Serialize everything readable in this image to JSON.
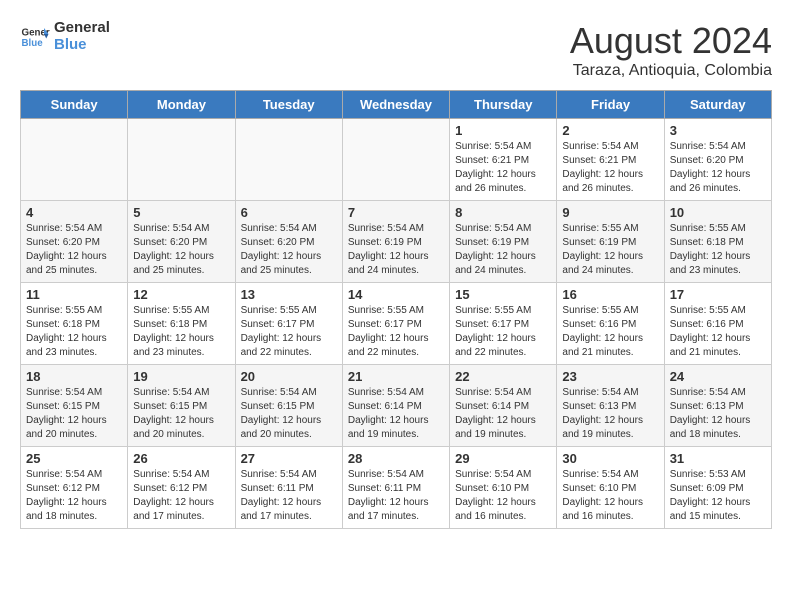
{
  "logo": {
    "line1": "General",
    "line2": "Blue"
  },
  "title": "August 2024",
  "subtitle": "Taraza, Antioquia, Colombia",
  "weekdays": [
    "Sunday",
    "Monday",
    "Tuesday",
    "Wednesday",
    "Thursday",
    "Friday",
    "Saturday"
  ],
  "weeks": [
    [
      {
        "day": "",
        "info": ""
      },
      {
        "day": "",
        "info": ""
      },
      {
        "day": "",
        "info": ""
      },
      {
        "day": "",
        "info": ""
      },
      {
        "day": "1",
        "info": "Sunrise: 5:54 AM\nSunset: 6:21 PM\nDaylight: 12 hours\nand 26 minutes."
      },
      {
        "day": "2",
        "info": "Sunrise: 5:54 AM\nSunset: 6:21 PM\nDaylight: 12 hours\nand 26 minutes."
      },
      {
        "day": "3",
        "info": "Sunrise: 5:54 AM\nSunset: 6:20 PM\nDaylight: 12 hours\nand 26 minutes."
      }
    ],
    [
      {
        "day": "4",
        "info": "Sunrise: 5:54 AM\nSunset: 6:20 PM\nDaylight: 12 hours\nand 25 minutes."
      },
      {
        "day": "5",
        "info": "Sunrise: 5:54 AM\nSunset: 6:20 PM\nDaylight: 12 hours\nand 25 minutes."
      },
      {
        "day": "6",
        "info": "Sunrise: 5:54 AM\nSunset: 6:20 PM\nDaylight: 12 hours\nand 25 minutes."
      },
      {
        "day": "7",
        "info": "Sunrise: 5:54 AM\nSunset: 6:19 PM\nDaylight: 12 hours\nand 24 minutes."
      },
      {
        "day": "8",
        "info": "Sunrise: 5:54 AM\nSunset: 6:19 PM\nDaylight: 12 hours\nand 24 minutes."
      },
      {
        "day": "9",
        "info": "Sunrise: 5:55 AM\nSunset: 6:19 PM\nDaylight: 12 hours\nand 24 minutes."
      },
      {
        "day": "10",
        "info": "Sunrise: 5:55 AM\nSunset: 6:18 PM\nDaylight: 12 hours\nand 23 minutes."
      }
    ],
    [
      {
        "day": "11",
        "info": "Sunrise: 5:55 AM\nSunset: 6:18 PM\nDaylight: 12 hours\nand 23 minutes."
      },
      {
        "day": "12",
        "info": "Sunrise: 5:55 AM\nSunset: 6:18 PM\nDaylight: 12 hours\nand 23 minutes."
      },
      {
        "day": "13",
        "info": "Sunrise: 5:55 AM\nSunset: 6:17 PM\nDaylight: 12 hours\nand 22 minutes."
      },
      {
        "day": "14",
        "info": "Sunrise: 5:55 AM\nSunset: 6:17 PM\nDaylight: 12 hours\nand 22 minutes."
      },
      {
        "day": "15",
        "info": "Sunrise: 5:55 AM\nSunset: 6:17 PM\nDaylight: 12 hours\nand 22 minutes."
      },
      {
        "day": "16",
        "info": "Sunrise: 5:55 AM\nSunset: 6:16 PM\nDaylight: 12 hours\nand 21 minutes."
      },
      {
        "day": "17",
        "info": "Sunrise: 5:55 AM\nSunset: 6:16 PM\nDaylight: 12 hours\nand 21 minutes."
      }
    ],
    [
      {
        "day": "18",
        "info": "Sunrise: 5:54 AM\nSunset: 6:15 PM\nDaylight: 12 hours\nand 20 minutes."
      },
      {
        "day": "19",
        "info": "Sunrise: 5:54 AM\nSunset: 6:15 PM\nDaylight: 12 hours\nand 20 minutes."
      },
      {
        "day": "20",
        "info": "Sunrise: 5:54 AM\nSunset: 6:15 PM\nDaylight: 12 hours\nand 20 minutes."
      },
      {
        "day": "21",
        "info": "Sunrise: 5:54 AM\nSunset: 6:14 PM\nDaylight: 12 hours\nand 19 minutes."
      },
      {
        "day": "22",
        "info": "Sunrise: 5:54 AM\nSunset: 6:14 PM\nDaylight: 12 hours\nand 19 minutes."
      },
      {
        "day": "23",
        "info": "Sunrise: 5:54 AM\nSunset: 6:13 PM\nDaylight: 12 hours\nand 19 minutes."
      },
      {
        "day": "24",
        "info": "Sunrise: 5:54 AM\nSunset: 6:13 PM\nDaylight: 12 hours\nand 18 minutes."
      }
    ],
    [
      {
        "day": "25",
        "info": "Sunrise: 5:54 AM\nSunset: 6:12 PM\nDaylight: 12 hours\nand 18 minutes."
      },
      {
        "day": "26",
        "info": "Sunrise: 5:54 AM\nSunset: 6:12 PM\nDaylight: 12 hours\nand 17 minutes."
      },
      {
        "day": "27",
        "info": "Sunrise: 5:54 AM\nSunset: 6:11 PM\nDaylight: 12 hours\nand 17 minutes."
      },
      {
        "day": "28",
        "info": "Sunrise: 5:54 AM\nSunset: 6:11 PM\nDaylight: 12 hours\nand 17 minutes."
      },
      {
        "day": "29",
        "info": "Sunrise: 5:54 AM\nSunset: 6:10 PM\nDaylight: 12 hours\nand 16 minutes."
      },
      {
        "day": "30",
        "info": "Sunrise: 5:54 AM\nSunset: 6:10 PM\nDaylight: 12 hours\nand 16 minutes."
      },
      {
        "day": "31",
        "info": "Sunrise: 5:53 AM\nSunset: 6:09 PM\nDaylight: 12 hours\nand 15 minutes."
      }
    ]
  ]
}
